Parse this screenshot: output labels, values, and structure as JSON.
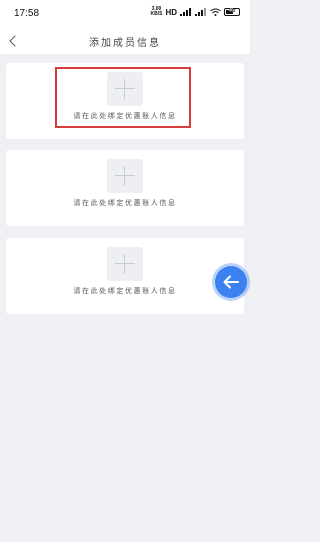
{
  "status_bar": {
    "time": "17:58",
    "net_speed_value": "3.00",
    "net_speed_unit": "KB/S",
    "network_badge": "HD",
    "battery": "45"
  },
  "nav": {
    "title": "添加成员信息"
  },
  "cards": [
    {
      "label": "请在此处绑定优惠账人信息"
    },
    {
      "label": "请在此处绑定优惠账人信息"
    },
    {
      "label": "请在此处绑定优惠账人信息"
    }
  ],
  "colors": {
    "highlight": "#d93a3a",
    "float_button": "#3b82f0"
  }
}
